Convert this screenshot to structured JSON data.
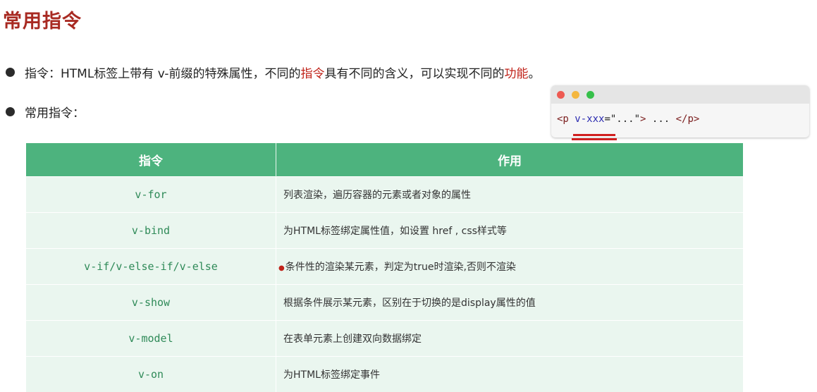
{
  "title": "常用指令",
  "bullet1": {
    "part1": "指令：HTML标签上带有 v-前缀的特殊属性，不同的",
    "hl1": "指令",
    "part2": "具有不同的含义，可以实现不同的",
    "hl2": "功能",
    "part3": "。"
  },
  "bullet2": "常用指令：",
  "code_window": {
    "tag_open": "<p",
    "attr": "v-xxx",
    "eq_val": "=\"...\"",
    "close_bracket": ">",
    "middle": " ... ",
    "tag_close": "</p>",
    "lights": [
      "#ee5a52",
      "#f4b73f",
      "#36c04a"
    ]
  },
  "table": {
    "headers": [
      "指令",
      "作用"
    ],
    "rows": [
      {
        "directive": "v-for",
        "usage": "列表渲染，遍历容器的元素或者对象的属性"
      },
      {
        "directive": "v-bind",
        "usage": "为HTML标签绑定属性值，如设置 href , css样式等"
      },
      {
        "directive": "v-if/v-else-if/v-else",
        "usage": "条件性的渲染某元素，判定为true时渲染,否则不渲染"
      },
      {
        "directive": "v-show",
        "usage": "根据条件展示某元素，区别在于切换的是display属性的值"
      },
      {
        "directive": "v-model",
        "usage": "在表单元素上创建双向数据绑定"
      },
      {
        "directive": "v-on",
        "usage": "为HTML标签绑定事件"
      }
    ]
  },
  "colors": {
    "title": "#a82a22",
    "header": "#4db37e",
    "highlight": "#c0231a"
  }
}
